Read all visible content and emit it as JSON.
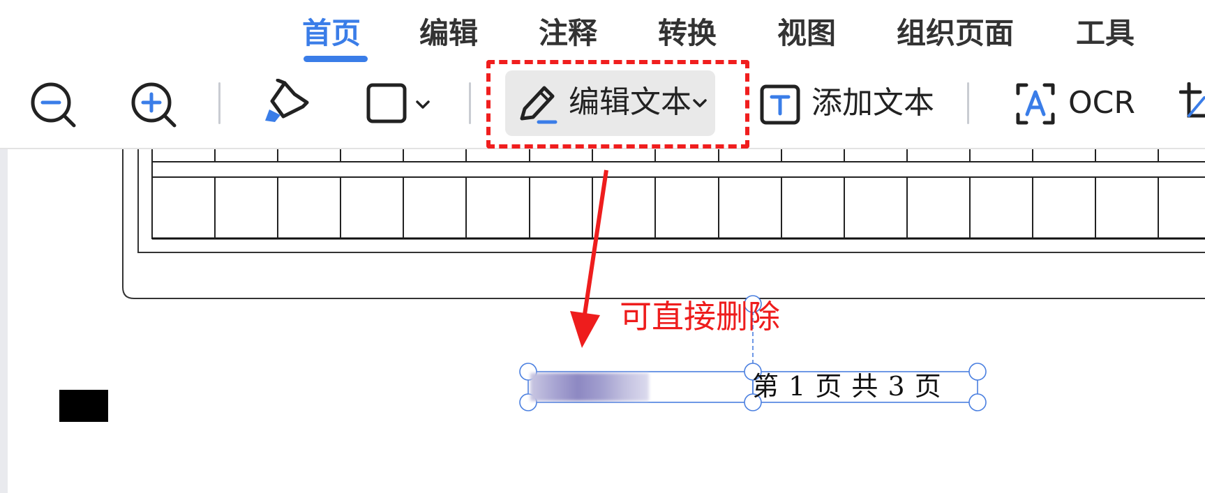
{
  "tabs": [
    {
      "label": "首页",
      "active": true
    },
    {
      "label": "编辑",
      "active": false
    },
    {
      "label": "注释",
      "active": false
    },
    {
      "label": "转换",
      "active": false
    },
    {
      "label": "视图",
      "active": false
    },
    {
      "label": "组织页面",
      "active": false
    },
    {
      "label": "工具",
      "active": false
    }
  ],
  "toolbar": {
    "zoom_out_icon": "zoom-out-icon",
    "zoom_in_icon": "zoom-in-icon",
    "highlighter_icon": "highlighter-icon",
    "shape_icon": "rectangle-shape-icon",
    "edit_text_label": "编辑文本",
    "add_text_label": "添加文本",
    "ocr_label": "OCR"
  },
  "document": {
    "annotation_text": "可直接删除",
    "page_footer": "第 1 页 共 3 页"
  },
  "colors": {
    "accent": "#3a7de8",
    "annotation_red": "#f01e1e",
    "selection_blue": "#4a7fe0"
  }
}
